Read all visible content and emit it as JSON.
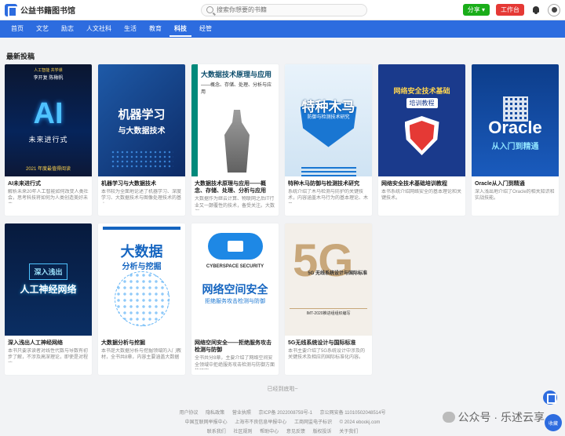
{
  "header": {
    "site_name": "公益书籍图书馆",
    "search_placeholder": "搜索你想要的书籍",
    "share_label": "分享",
    "workspace_label": "工作台"
  },
  "nav": {
    "items": [
      {
        "label": "首页",
        "active": false
      },
      {
        "label": "文艺",
        "active": false
      },
      {
        "label": "励志",
        "active": false
      },
      {
        "label": "人文社科",
        "active": false
      },
      {
        "label": "生活",
        "active": false
      },
      {
        "label": "教育",
        "active": false
      },
      {
        "label": "科技",
        "active": true
      },
      {
        "label": "经管",
        "active": false
      }
    ]
  },
  "section_title": "最新投稿",
  "books": [
    {
      "title": "AI未来进行式",
      "desc": "解析未来20年人工智能如何改变人类社会，思考科技将如何为人类创造美好未来",
      "cover": {
        "big": "AI",
        "sub": "未来进行式",
        "top": "人工智能  共学课",
        "auth": "李开复  陈楸帆",
        "bot": "2021 年度最值得阅读"
      }
    },
    {
      "title": "机器学习与大数据技术",
      "desc": "本书较为全面地论述了机器学习、深度学习、大数据技术与图像处理技术的基本",
      "cover": {
        "t1": "机器学习",
        "t2": "与大数据技术"
      }
    },
    {
      "title": "大数据技术原理与应用——概念、存储、处理、分析与应用",
      "desc": "大数据作为继云计算、物联网之后IT行业又一颠覆性的技术，备受关注。大数据",
      "cover": {
        "t1": "大数据技术原理与应用",
        "t2": "——概念、存储、处理、分析与应用"
      }
    },
    {
      "title": "特种木马防御与检测技术研究",
      "desc": "系统介绍了木马检测与防护的关键技术，内容涵盖木马行为的基本理论、木马",
      "cover": {
        "t1": "特种木马",
        "t2": "防御与检测技术研究"
      }
    },
    {
      "title": "网络安全技术基础培训教程",
      "desc": "本书系统介绍网络安全的基本理论和关键技术。",
      "cover": {
        "t1": "网络安全技术基础",
        "t2": "培训教程"
      }
    },
    {
      "title": "Oracle从入门到精通",
      "desc": "深入浅出地介绍了Oracle的相关知识和实战技能。",
      "cover": {
        "t1": "Oracle",
        "t2": "从入门到精通"
      }
    },
    {
      "title": "深入浅出人工神经网络",
      "desc": "本书只要求读者对线性代数与导数有初步了解，不涉及高深理论，即使是对程序",
      "cover": {
        "t1": "深入浅出",
        "t2": "人工神经网络"
      }
    },
    {
      "title": "大数据分析与挖掘",
      "desc": "本书是大数据分析与挖掘领域的入门教材，全书共8章，内容主要涵盖大数据",
      "cover": {
        "t1": "大数据",
        "t2": "分析与挖掘"
      }
    },
    {
      "title": "网络空间安全——拒绝服务攻击检测与防御",
      "desc": "全书共分8章，主要介绍了网络空间安全领域中拒绝服务攻击检测与防御方面的研究",
      "cover": {
        "t0": "CYBERSPACE SECURITY",
        "t1": "网络空间安全",
        "t2": "拒绝服务攻击检测与防御"
      }
    },
    {
      "title": "5G无线系统设计与国际标准",
      "desc": "本书主要介绍了5G系统设计中涉及的关键技术及相应的国际标准化内容。",
      "cover": {
        "num": "5G",
        "t1": "5G 无线系统设计与国际标准",
        "t2": "IMT-2020推进组组织编写"
      }
    }
  ],
  "loaded_text": "已经到底啦~",
  "footer": {
    "line1": [
      "用户协议",
      "隐私政策",
      "营业执照",
      "京ICP备 2022008759号-1",
      "京公网安备 11010502048514号"
    ],
    "line2": [
      "中国互联网举报中心",
      "上海市不良信息举报中心",
      "工商网监电子标识",
      "© 2024 ebookj.com"
    ],
    "line3": [
      "联系我们",
      "社区规则",
      "帮助中心",
      "意见反馈",
      "版权投诉",
      "关于我们"
    ]
  },
  "watermark": "公众号 · 乐述云享",
  "fav_label": "收藏",
  "colors": {
    "primary": "#2d6cdf",
    "share": "#1aad19",
    "workspace": "#e53935",
    "background": "#f2f3f5"
  }
}
